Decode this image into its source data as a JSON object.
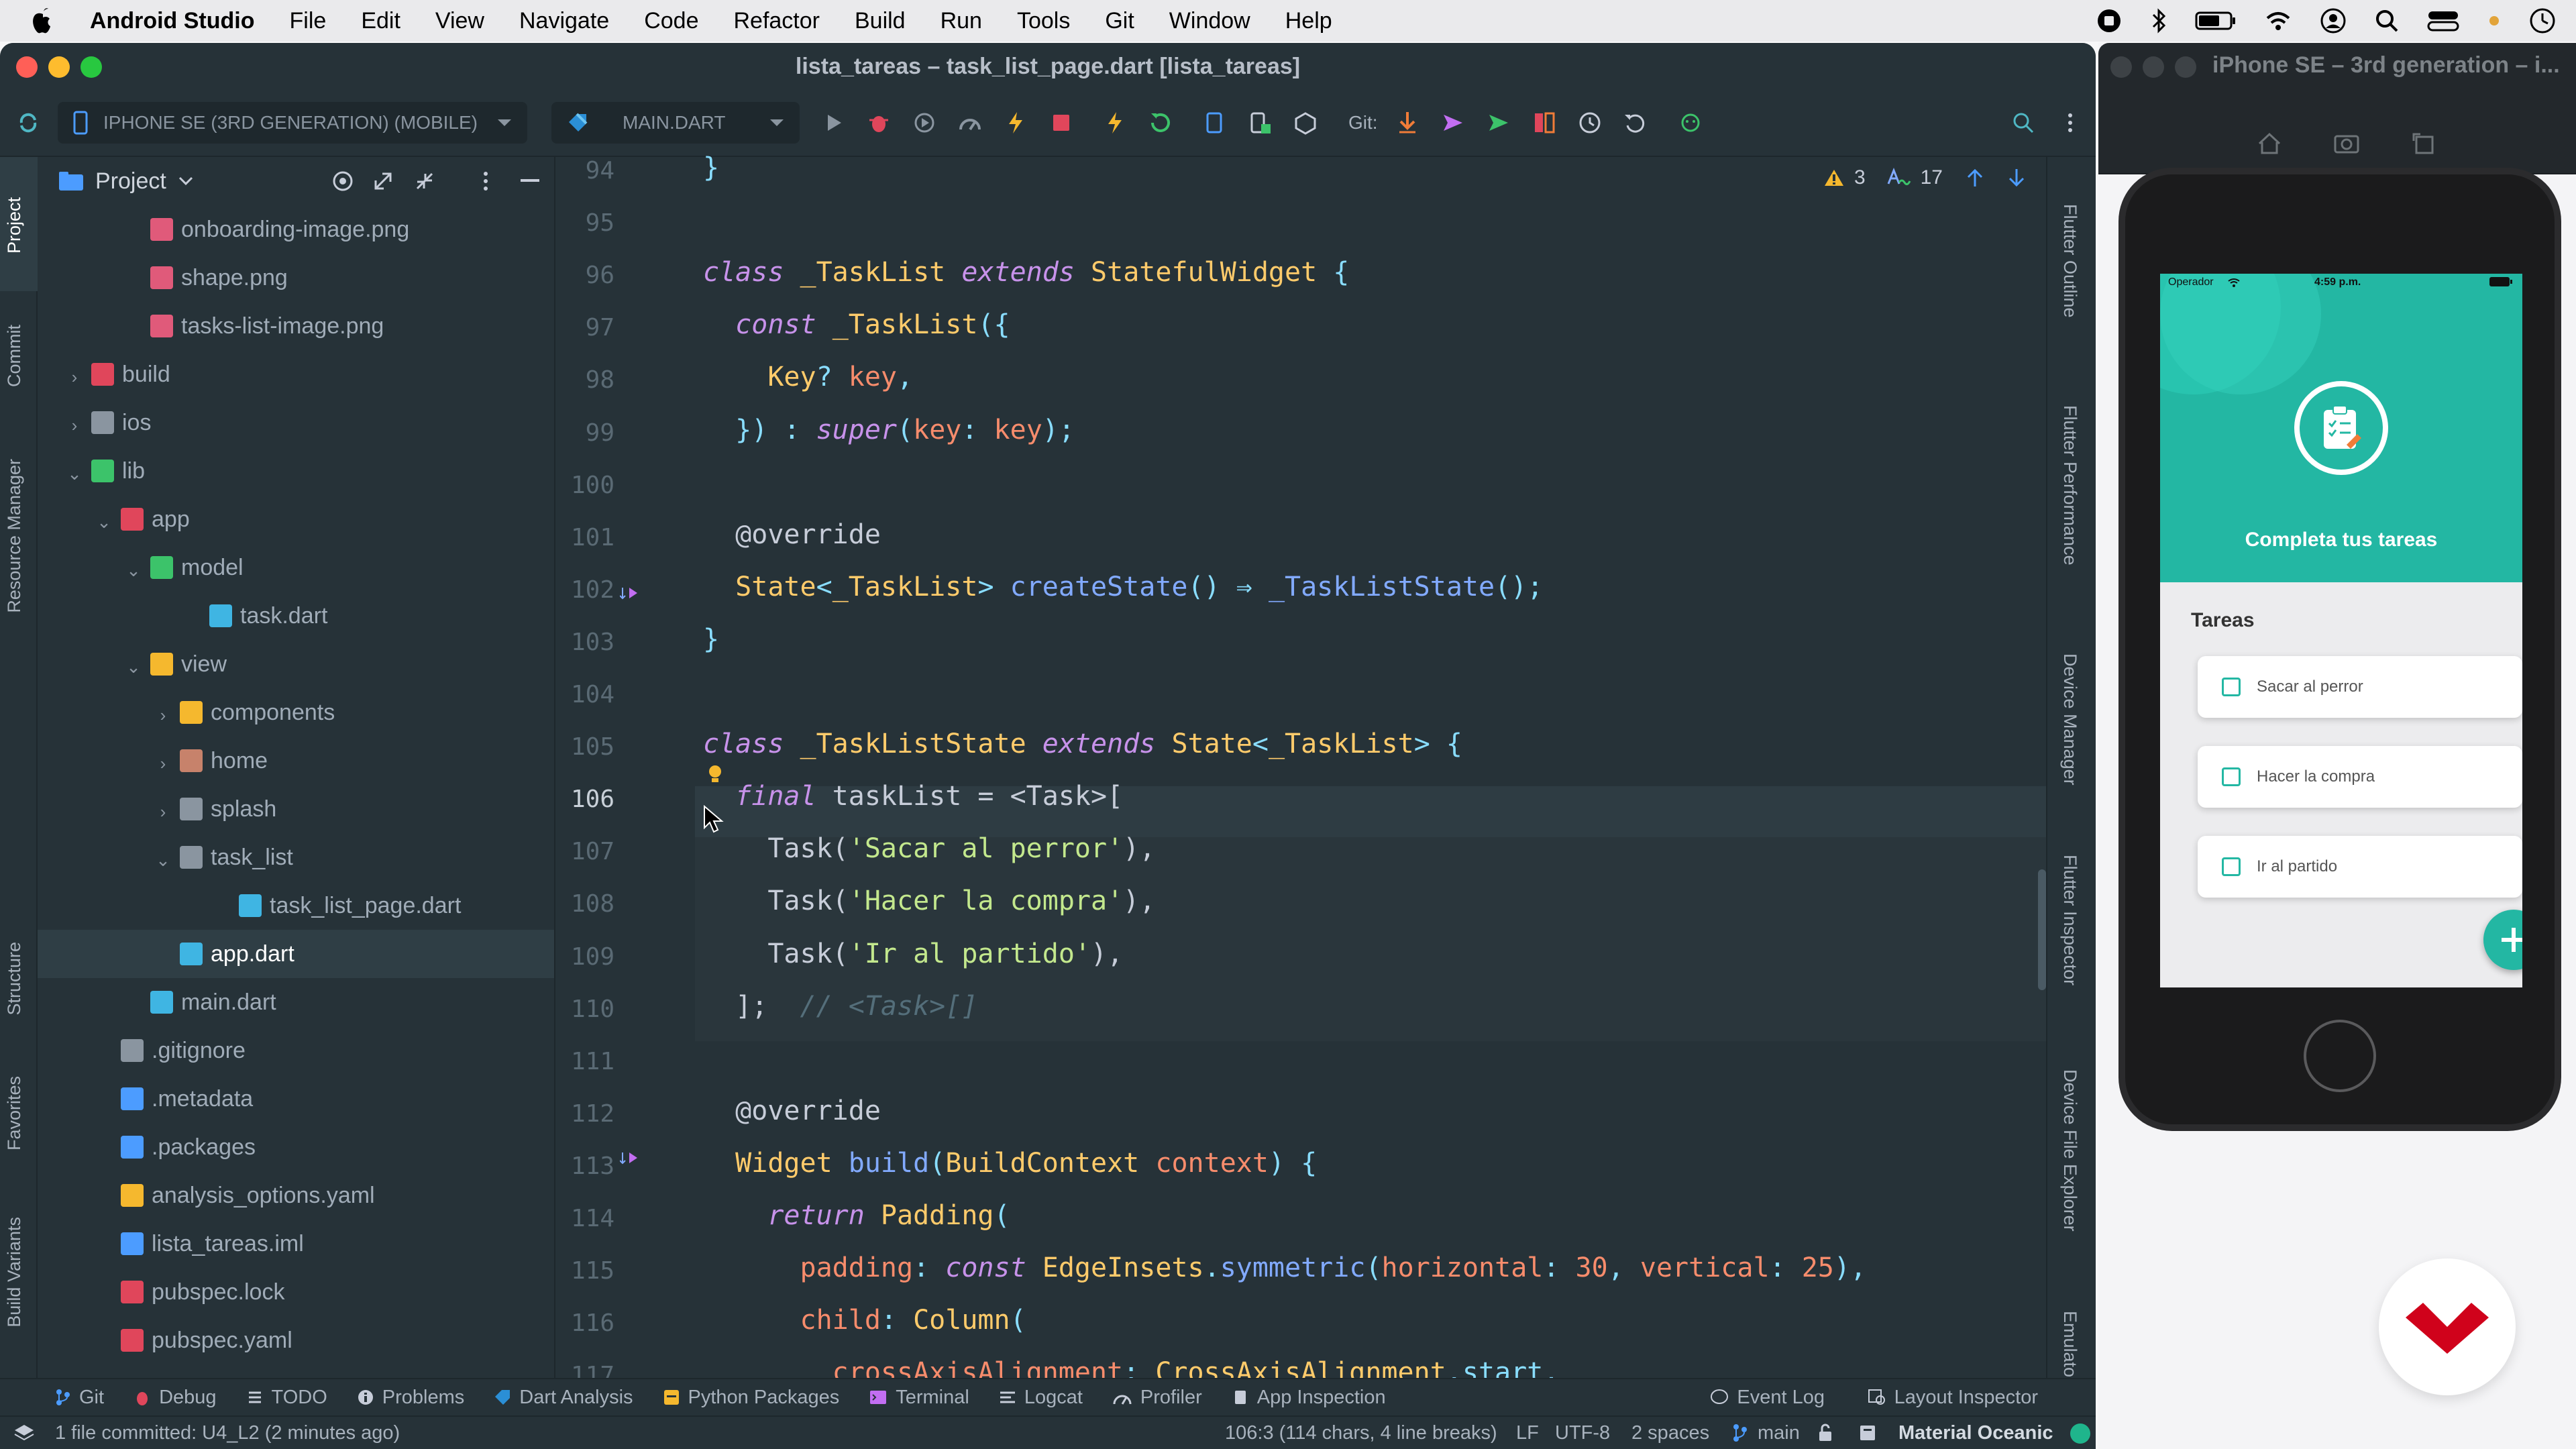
{
  "menubar": {
    "app_name": "Android Studio",
    "items": [
      "File",
      "Edit",
      "View",
      "Navigate",
      "Code",
      "Refactor",
      "Build",
      "Run",
      "Tools",
      "Git",
      "Window",
      "Help"
    ]
  },
  "window": {
    "title": "lista_tareas – task_list_page.dart [lista_tareas]"
  },
  "toolbar": {
    "device": "IPHONE SE (3RD GENERATION) (MOBILE)",
    "config": "MAIN.DART",
    "git_label": "Git:"
  },
  "left_tabs": [
    "Project",
    "Commit",
    "Resource Manager",
    "Structure",
    "Favorites",
    "Build Variants"
  ],
  "right_tabs": [
    "Flutter Outline",
    "Flutter Performance",
    "Device Manager",
    "Flutter Inspector",
    "Device File Explorer",
    "Emulator"
  ],
  "project": {
    "title": "Project",
    "tree": [
      {
        "label": "onboarding-image.png",
        "type": "image"
      },
      {
        "label": "shape.png",
        "type": "image"
      },
      {
        "label": "tasks-list-image.png",
        "type": "image"
      },
      {
        "label": "build",
        "type": "folder-red"
      },
      {
        "label": "ios",
        "type": "folder-tools"
      },
      {
        "label": "lib",
        "type": "folder-green"
      },
      {
        "label": "app",
        "type": "folder-pkg"
      },
      {
        "label": "model",
        "type": "folder-green"
      },
      {
        "label": "task.dart",
        "type": "dart"
      },
      {
        "label": "view",
        "type": "folder-yellow"
      },
      {
        "label": "components",
        "type": "folder-yellow"
      },
      {
        "label": "home",
        "type": "folder-brown"
      },
      {
        "label": "splash",
        "type": "folder-plain"
      },
      {
        "label": "task_list",
        "type": "folder-open"
      },
      {
        "label": "task_list_page.dart",
        "type": "dart"
      },
      {
        "label": "app.dart",
        "type": "dart"
      },
      {
        "label": "main.dart",
        "type": "dart"
      },
      {
        "label": ".gitignore",
        "type": "git"
      },
      {
        "label": ".metadata",
        "type": "flutter"
      },
      {
        "label": ".packages",
        "type": "flutter"
      },
      {
        "label": "analysis_options.yaml",
        "type": "yaml"
      },
      {
        "label": "lista_tareas.iml",
        "type": "iml"
      },
      {
        "label": "pubspec.lock",
        "type": "lock"
      },
      {
        "label": "pubspec.yaml",
        "type": "lock"
      }
    ]
  },
  "editor": {
    "line_numbers": [
      "94",
      "95",
      "96",
      "97",
      "98",
      "99",
      "100",
      "101",
      "102",
      "103",
      "104",
      "105",
      "106",
      "107",
      "108",
      "109",
      "110",
      "111",
      "112",
      "113",
      "114",
      "115",
      "116",
      "117"
    ],
    "current_line": "106",
    "warnings": "3",
    "typos": "17",
    "lines": [
      [
        [
          "}",
          "pun"
        ]
      ],
      [],
      [
        [
          "class",
          "kw"
        ],
        [
          " ",
          " "
        ],
        [
          "_TaskList",
          "cls"
        ],
        [
          " ",
          " "
        ],
        [
          "extends",
          "kw"
        ],
        [
          " ",
          " "
        ],
        [
          "StatefulWidget",
          "cls"
        ],
        [
          " {",
          "pun"
        ]
      ],
      [
        [
          "  ",
          " "
        ],
        [
          "const",
          "kw"
        ],
        [
          " ",
          " "
        ],
        [
          "_TaskList",
          "cls"
        ],
        [
          "({",
          "pun"
        ]
      ],
      [
        [
          "    ",
          " "
        ],
        [
          "Key",
          "cls"
        ],
        [
          "? ",
          "pun"
        ],
        [
          "key",
          "prm"
        ],
        [
          ",",
          "pun"
        ]
      ],
      [
        [
          "  ",
          " "
        ],
        [
          "})",
          "pun"
        ],
        [
          " : ",
          "pun"
        ],
        [
          "super",
          "kw"
        ],
        [
          "(",
          "pun"
        ],
        [
          "key",
          "prm"
        ],
        [
          ": ",
          "pun"
        ],
        [
          "key",
          "prm"
        ],
        [
          ");",
          "pun"
        ]
      ],
      [],
      [
        [
          "  ",
          " "
        ],
        [
          "@override",
          "ann"
        ]
      ],
      [
        [
          "  ",
          " "
        ],
        [
          "State",
          "cls"
        ],
        [
          "<",
          "pun"
        ],
        [
          "_TaskList",
          "cls"
        ],
        [
          "> ",
          "pun"
        ],
        [
          "createState",
          "fn"
        ],
        [
          "() ⇒ ",
          "pun"
        ],
        [
          "_TaskListState",
          "fn"
        ],
        [
          "();",
          "pun"
        ]
      ],
      [
        [
          "}",
          "pun"
        ]
      ],
      [],
      [
        [
          "class",
          "kw"
        ],
        [
          " ",
          " "
        ],
        [
          "_TaskListState",
          "cls"
        ],
        [
          " ",
          " "
        ],
        [
          "extends",
          "kw"
        ],
        [
          " ",
          " "
        ],
        [
          "State",
          "cls"
        ],
        [
          "<",
          "pun"
        ],
        [
          "_TaskList",
          "cls"
        ],
        [
          "> {",
          "pun"
        ]
      ],
      [
        [
          "  ",
          " "
        ],
        [
          "final",
          "kw"
        ],
        [
          " taskList = <Task>[",
          "ann"
        ]
      ],
      [
        [
          "    Task(",
          "ann"
        ],
        [
          "'Sacar al perror'",
          "str"
        ],
        [
          "),",
          "ann"
        ]
      ],
      [
        [
          "    Task(",
          "ann"
        ],
        [
          "'Hacer la compra'",
          "str"
        ],
        [
          "),",
          "ann"
        ]
      ],
      [
        [
          "    Task(",
          "ann"
        ],
        [
          "'Ir al partido'",
          "str"
        ],
        [
          "),",
          "ann"
        ]
      ],
      [
        [
          "  ];",
          "ann"
        ],
        [
          "  ",
          " "
        ],
        [
          "// <Task>[]",
          "com"
        ]
      ],
      [],
      [
        [
          "  ",
          " "
        ],
        [
          "@override",
          "ann"
        ]
      ],
      [
        [
          "  ",
          " "
        ],
        [
          "Widget",
          "cls"
        ],
        [
          " ",
          " "
        ],
        [
          "build",
          "fn"
        ],
        [
          "(",
          "pun"
        ],
        [
          "BuildContext",
          "cls"
        ],
        [
          " ",
          " "
        ],
        [
          "context",
          "prm"
        ],
        [
          ") {",
          "pun"
        ]
      ],
      [
        [
          "    ",
          " "
        ],
        [
          "return",
          "kw"
        ],
        [
          " ",
          " "
        ],
        [
          "Padding",
          "cls"
        ],
        [
          "(",
          "pun"
        ]
      ],
      [
        [
          "      ",
          " "
        ],
        [
          "padding",
          "prm"
        ],
        [
          ": ",
          "pun"
        ],
        [
          "const",
          "kw"
        ],
        [
          " ",
          " "
        ],
        [
          "EdgeInsets",
          "cls"
        ],
        [
          ".",
          "pun"
        ],
        [
          "symmetric",
          "fn"
        ],
        [
          "(",
          "pun"
        ],
        [
          "horizontal",
          "prm"
        ],
        [
          ": ",
          "pun"
        ],
        [
          "30",
          "num"
        ],
        [
          ", ",
          "pun"
        ],
        [
          "vertical",
          "prm"
        ],
        [
          ": ",
          "pun"
        ],
        [
          "25",
          "num"
        ],
        [
          "),",
          "pun"
        ]
      ],
      [
        [
          "      ",
          " "
        ],
        [
          "child",
          "prm"
        ],
        [
          ": ",
          "pun"
        ],
        [
          "Column",
          "cls"
        ],
        [
          "(",
          "pun"
        ]
      ],
      [
        [
          "        ",
          " "
        ],
        [
          "crossAxisAlignment",
          "prm"
        ],
        [
          ": ",
          "pun"
        ],
        [
          "CrossAxisAlignment",
          "cls"
        ],
        [
          ".start,",
          "pun"
        ]
      ]
    ]
  },
  "toolwindows": [
    "Git",
    "Debug",
    "TODO",
    "Problems",
    "Dart Analysis",
    "Python Packages",
    "Terminal",
    "Logcat",
    "Profiler",
    "App Inspection"
  ],
  "toolwindows_right": [
    "Event Log",
    "Layout Inspector"
  ],
  "status": {
    "message": "1 file committed: U4_L2 (2 minutes ago)",
    "position": "106:3 (114 chars, 4 line breaks)",
    "line_sep": "LF",
    "encoding": "UTF-8",
    "indent": "2 spaces",
    "branch": "main",
    "theme": "Material Oceanic"
  },
  "emulator": {
    "title": "iPhone SE – 3rd generation – i...",
    "carrier": "Operador",
    "time": "4:59 p.m.",
    "header_title": "Completa tus tareas",
    "section_title": "Tareas",
    "tasks": [
      "Sacar al perror",
      "Hacer la compra",
      "Ir al partido"
    ]
  },
  "colors": {
    "teal": "#23b7a3",
    "editor_bg": "#263238",
    "logo_red": "#d0021b"
  }
}
